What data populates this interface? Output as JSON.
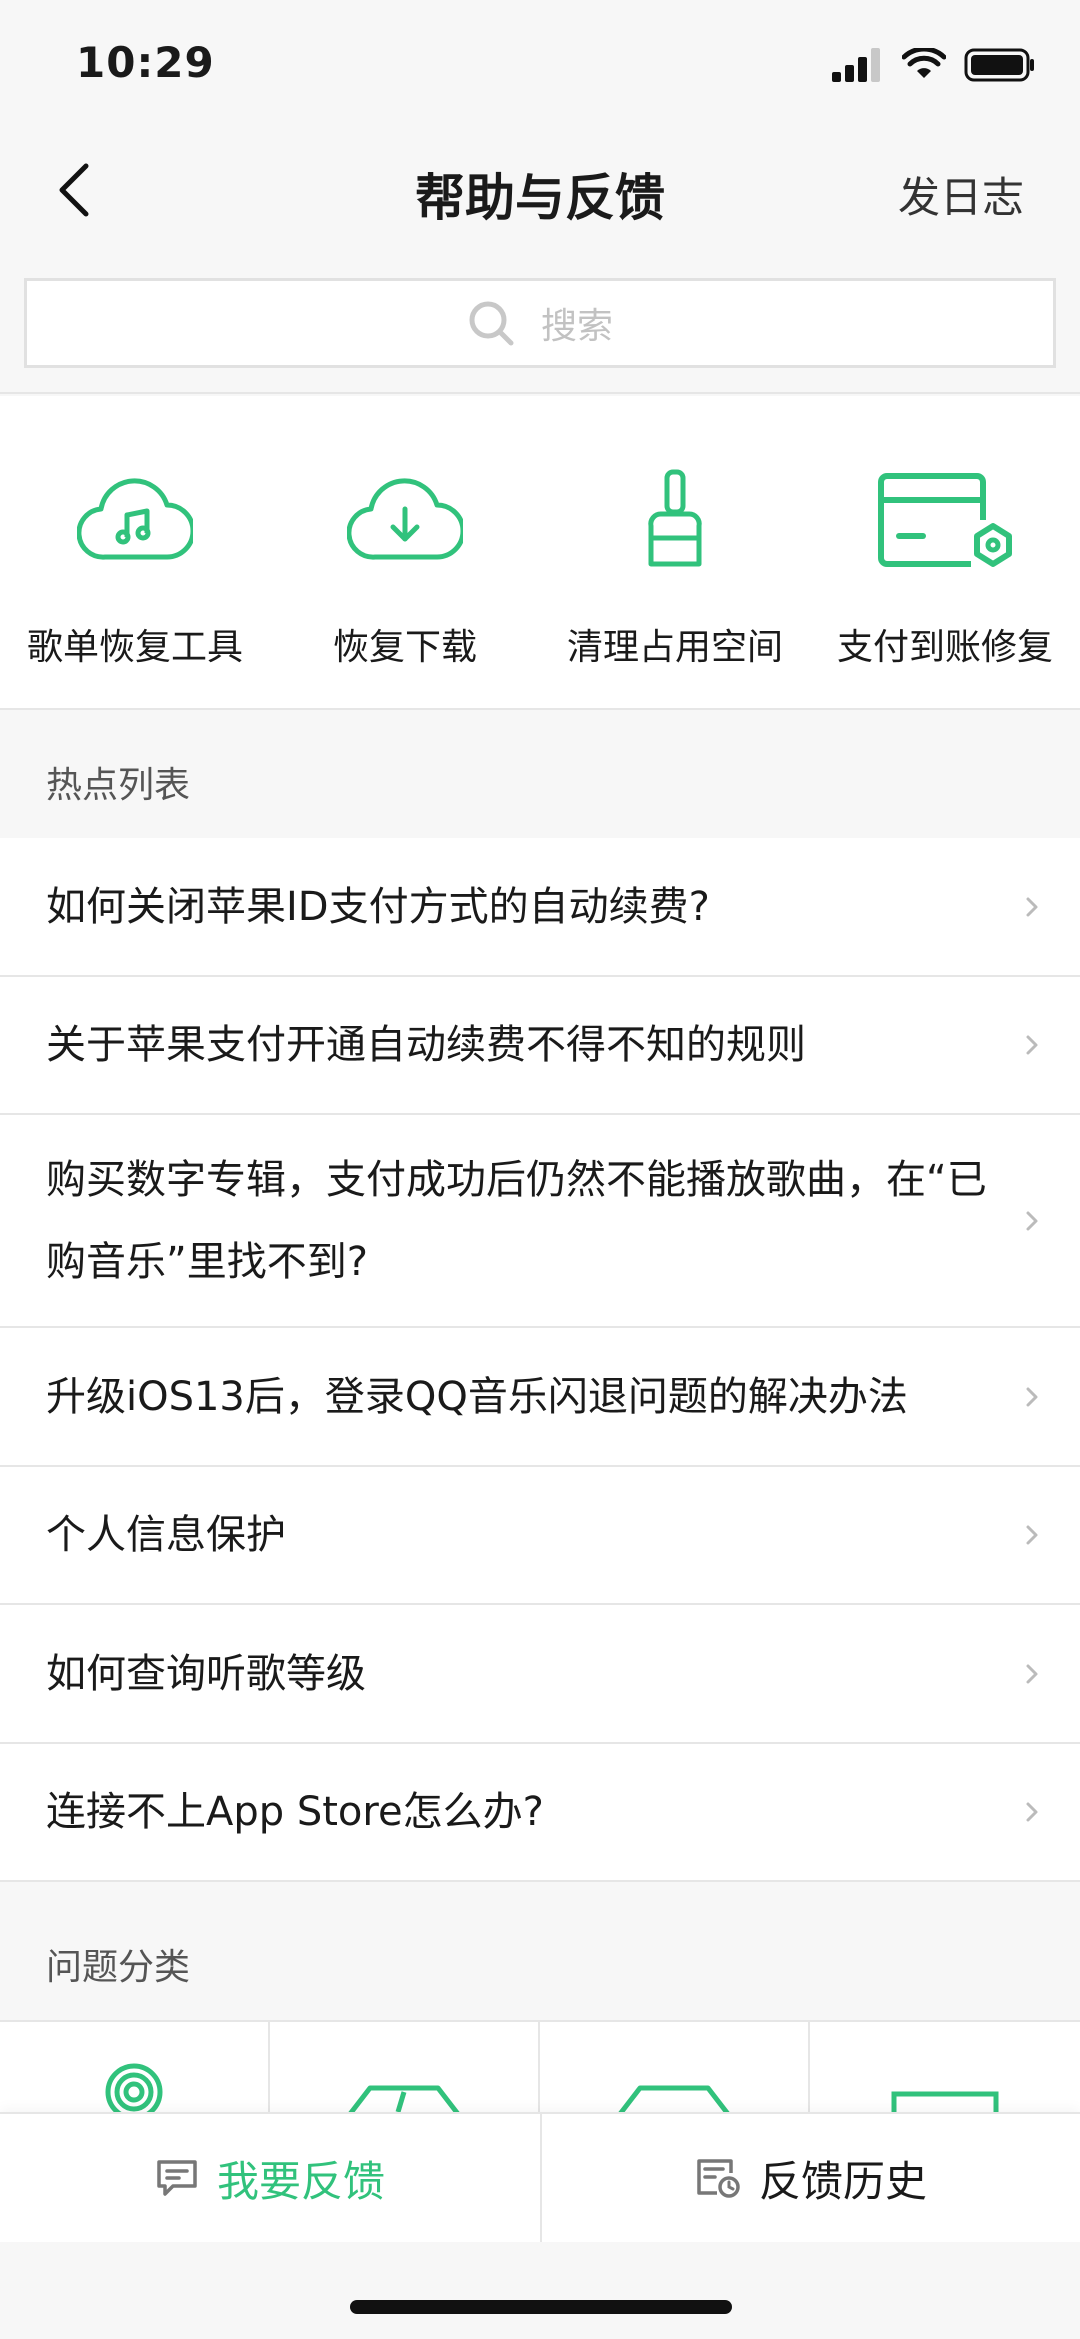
{
  "status_bar": {
    "time": "10:29"
  },
  "nav": {
    "title": "帮助与反馈",
    "right_action": "发日志"
  },
  "search": {
    "placeholder": "搜索"
  },
  "shortcuts": [
    {
      "label": "歌单恢复工具",
      "icon": "cloud-music-icon"
    },
    {
      "label": "恢复下载",
      "icon": "cloud-download-icon"
    },
    {
      "label": "清理占用空间",
      "icon": "brush-icon"
    },
    {
      "label": "支付到账修复",
      "icon": "card-repair-icon"
    }
  ],
  "hot_list": {
    "title": "热点列表",
    "items": [
      {
        "text": "如何关闭苹果ID支付方式的自动续费?"
      },
      {
        "text": "关于苹果支付开通自动续费不得不知的规则"
      },
      {
        "text": "购买数字专辑，支付成功后仍然不能播放歌曲，在“已购音乐”里找不到?"
      },
      {
        "text": "升级iOS13后，登录QQ音乐闪退问题的解决办法"
      },
      {
        "text": "个人信息保护"
      },
      {
        "text": "如何查询听歌等级"
      },
      {
        "text": "连接不上App Store怎么办?"
      }
    ]
  },
  "categories": {
    "title": "问题分类"
  },
  "bottom_bar": {
    "feedback_label": "我要反馈",
    "history_label": "反馈历史"
  },
  "colors": {
    "accent": "#31c27c",
    "background": "#f7f7f7",
    "divider": "#e6e6e6"
  }
}
